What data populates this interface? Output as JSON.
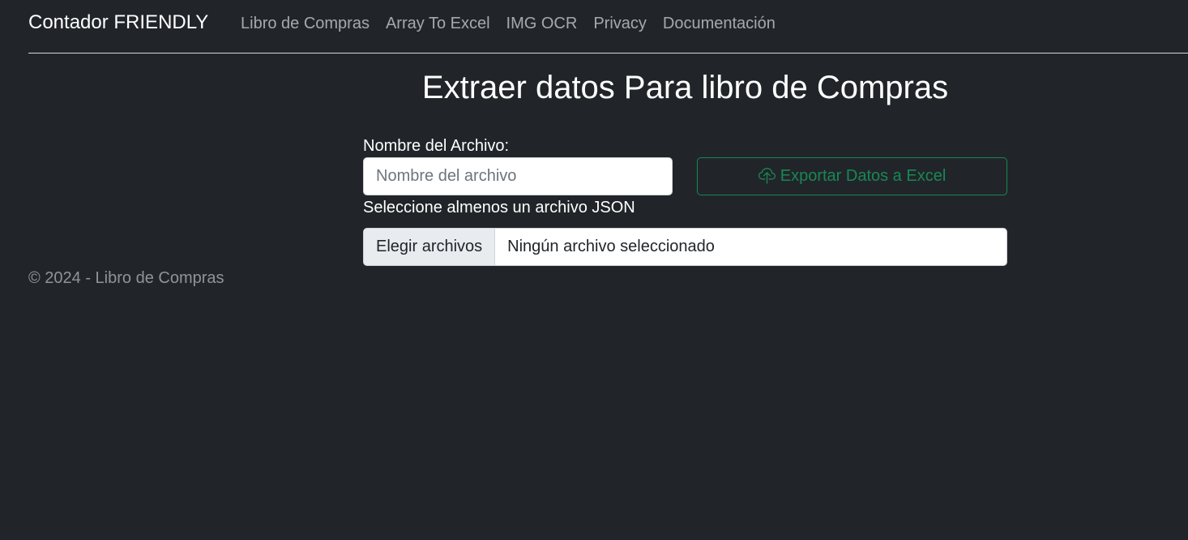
{
  "navbar": {
    "brand": "Contador FRIENDLY",
    "links": [
      "Libro de Compras",
      "Array To Excel",
      "IMG OCR",
      "Privacy",
      "Documentación"
    ]
  },
  "main": {
    "title": "Extraer datos Para libro de Compras",
    "filename_label": "Nombre del Archivo:",
    "filename_placeholder": "Nombre del archivo",
    "filename_value": "",
    "export_button": {
      "label": "Exportar Datos a Excel",
      "icon": "cloud-upload-icon"
    },
    "file_label": "Seleccione almenos un archivo JSON",
    "file_button_label": "Elegir archivos",
    "file_status": "Ningún archivo seleccionado"
  },
  "footer": {
    "text": "© 2024 - Libro de Compras"
  },
  "colors": {
    "background": "#212529",
    "accent_success": "#198754",
    "text_primary": "#ffffff"
  }
}
